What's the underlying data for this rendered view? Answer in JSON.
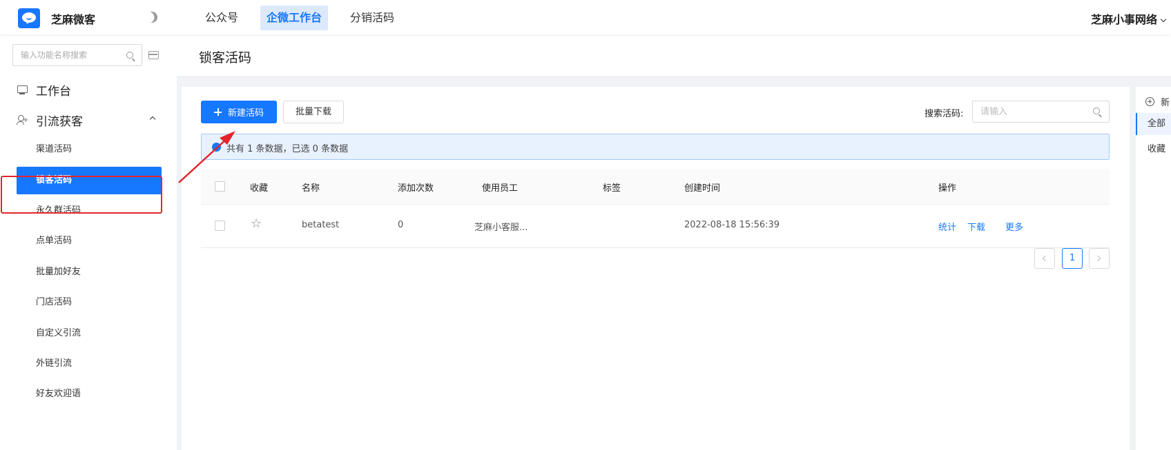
{
  "header": {
    "brand": "芝麻微客",
    "nav": [
      "公众号",
      "企微工作台",
      "分销活码"
    ],
    "account": "芝麻小事网络"
  },
  "sidebar": {
    "search_placeholder": "输入功能名称搜索",
    "workbench": "工作台",
    "group": "引流获客",
    "items": [
      "渠道活码",
      "锁客活码",
      "永久群活码",
      "点单活码",
      "批量加好友",
      "门店活码",
      "自定义引流",
      "外链引流",
      "好友欢迎语"
    ]
  },
  "page": {
    "title": "锁客活码"
  },
  "toolbar": {
    "new_label": "新建活码",
    "batch_download": "批量下载",
    "search_label": "搜索活码:",
    "search_placeholder": "请输入"
  },
  "info": {
    "text": "共有 1 条数据，已选 0 条数据"
  },
  "table": {
    "headers": {
      "fav": "收藏",
      "name": "名称",
      "adds": "添加次数",
      "staff": "使用员工",
      "tags": "标签",
      "created": "创建时间",
      "ops": "操作"
    },
    "rows": [
      {
        "name": "betatest",
        "adds": "0",
        "staff": "芝麻小客服...",
        "tags": "",
        "created": "2022-08-18 15:56:39",
        "ops": [
          "统计",
          "下载",
          "更多"
        ]
      }
    ]
  },
  "pagination": {
    "current": "1"
  },
  "right_panel": {
    "new_label": "新",
    "tabs": [
      "全部",
      "收藏"
    ]
  },
  "colors": {
    "primary": "#1677ff",
    "highlight_box": "#e5242b"
  }
}
